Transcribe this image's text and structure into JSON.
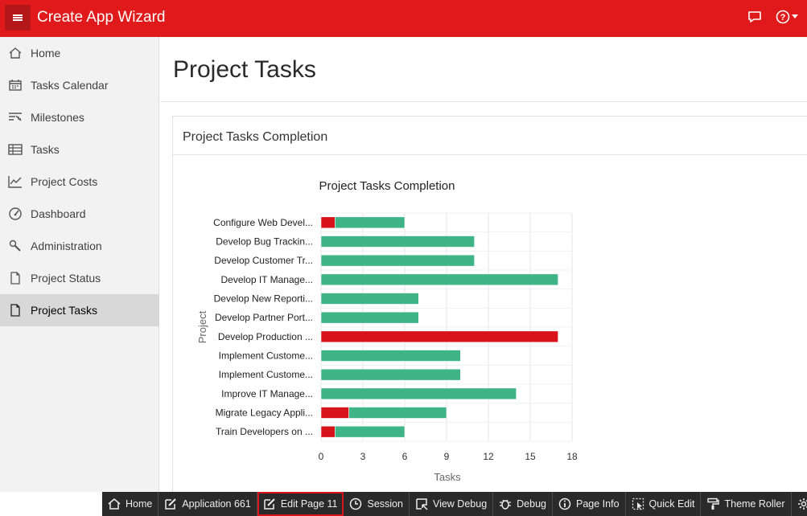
{
  "header": {
    "app_title": "Create App Wizard",
    "menu_icon": "hamburger-icon",
    "chat_icon": "chat-bubble-icon",
    "help_icon": "help-icon",
    "brand_color": "#e0191b"
  },
  "sidebar": {
    "items": [
      {
        "label": "Home",
        "icon": "home-icon"
      },
      {
        "label": "Tasks Calendar",
        "icon": "calendar-icon"
      },
      {
        "label": "Milestones",
        "icon": "milestones-icon"
      },
      {
        "label": "Tasks",
        "icon": "table-icon"
      },
      {
        "label": "Project Costs",
        "icon": "line-chart-icon"
      },
      {
        "label": "Dashboard",
        "icon": "dashboard-icon"
      },
      {
        "label": "Administration",
        "icon": "wrench-icon"
      },
      {
        "label": "Project Status",
        "icon": "file-icon"
      },
      {
        "label": "Project Tasks",
        "icon": "file-icon",
        "active": true
      }
    ]
  },
  "main": {
    "page_title": "Project Tasks",
    "region_title": "Project Tasks Completion"
  },
  "chart_data": {
    "type": "bar",
    "orientation": "horizontal",
    "stacked": true,
    "title": "Project Tasks Completion",
    "xlabel": "Tasks",
    "ylabel": "Project",
    "xlim": [
      0,
      18
    ],
    "xticks": [
      0,
      3,
      6,
      9,
      12,
      15,
      18
    ],
    "grid": true,
    "categories": [
      "Configure Web Devel...",
      "Develop Bug Trackin...",
      "Develop Customer Tr...",
      "Develop IT Manage...",
      "Develop New Reporti...",
      "Develop Partner Port...",
      "Develop Production ...",
      "Implement Custome...",
      "Implement Custome...",
      "Improve IT Manage...",
      "Migrate Legacy Appli...",
      "Train Developers on ..."
    ],
    "series": [
      {
        "color": "#d8131b",
        "values": [
          1,
          0,
          0,
          0,
          0,
          0,
          17,
          0,
          0,
          0,
          2,
          1
        ]
      },
      {
        "color": "#3fb486",
        "values": [
          5,
          11,
          11,
          17,
          7,
          7,
          0,
          10,
          10,
          14,
          7,
          5
        ]
      }
    ]
  },
  "devbar": {
    "items": [
      {
        "label": "Home",
        "icon": "home-icon"
      },
      {
        "label": "Application 661",
        "icon": "edit-icon"
      },
      {
        "label": "Edit Page 11",
        "icon": "edit-icon",
        "highlight": true
      },
      {
        "label": "Session",
        "icon": "clock-icon"
      },
      {
        "label": "View Debug",
        "icon": "view-debug-icon"
      },
      {
        "label": "Debug",
        "icon": "bug-icon"
      },
      {
        "label": "Page Info",
        "icon": "info-icon"
      },
      {
        "label": "Quick Edit",
        "icon": "quick-edit-icon"
      },
      {
        "label": "Theme Roller",
        "icon": "paint-roller-icon"
      },
      {
        "label": "",
        "icon": "gear-icon"
      }
    ]
  }
}
